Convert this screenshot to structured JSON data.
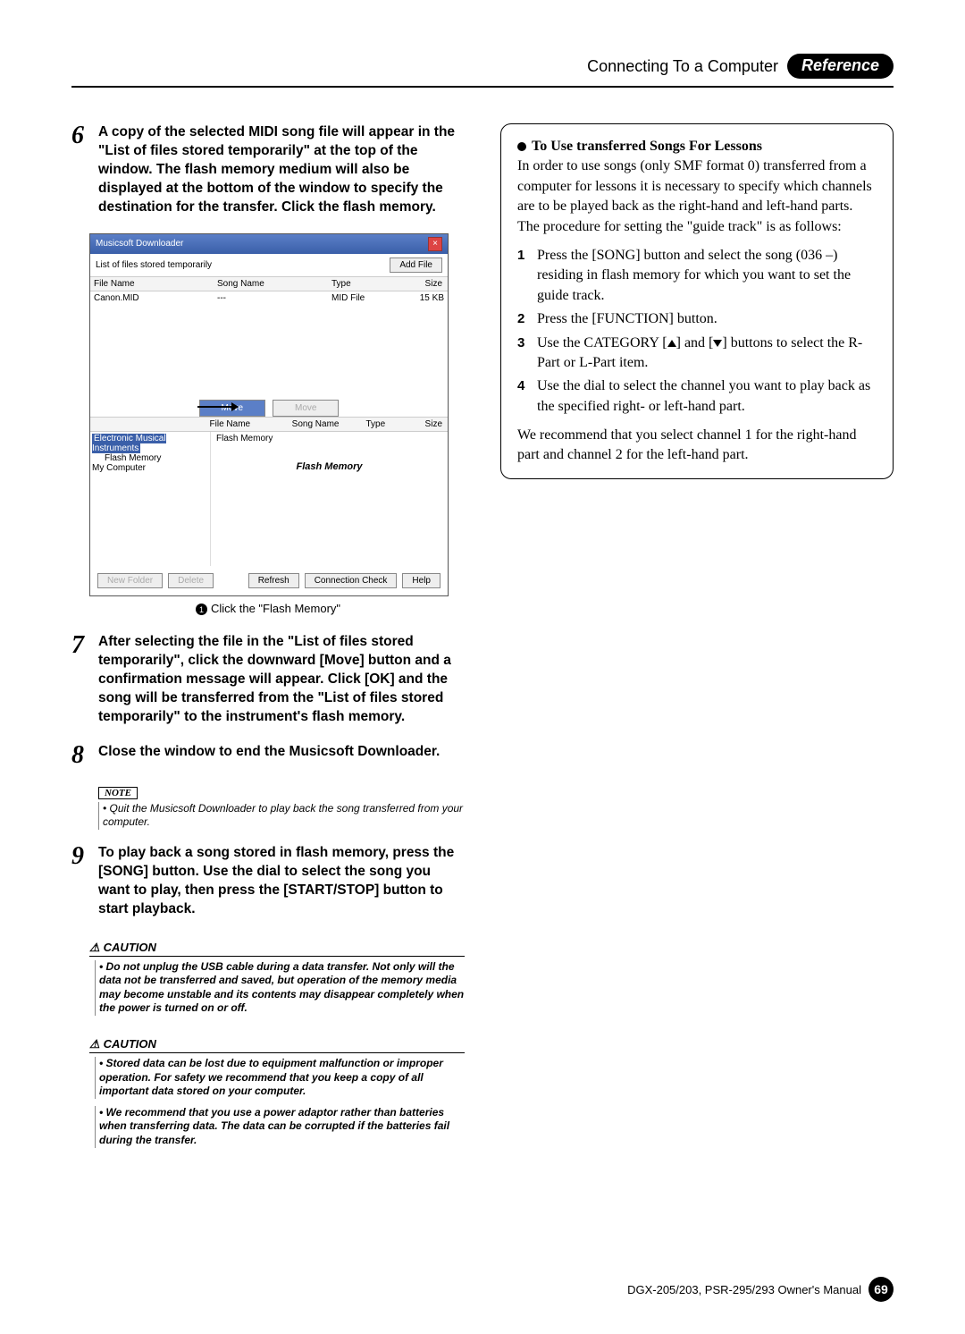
{
  "header": {
    "title": "Connecting To a Computer",
    "tag": "Reference"
  },
  "steps": {
    "s6": {
      "num": "6",
      "text": "A copy of the selected MIDI song file will appear in the \"List of files stored temporarily\" at the top of the window. The flash memory medium will also be displayed at the bottom of the window to specify the destination for the transfer. Click the flash memory."
    },
    "s7": {
      "num": "7",
      "text": "After selecting the file in the \"List of files stored temporarily\", click the downward [Move] button and a confirmation message will appear. Click [OK] and the song will be transferred from the \"List of files stored temporarily\" to the instrument's flash memory."
    },
    "s8": {
      "num": "8",
      "text": "Close the window to end the Musicsoft Downloader."
    },
    "s9": {
      "num": "9",
      "text": "To play back a song stored in flash memory, press the [SONG] button. Use the dial to select the song you want to play, then press the [START/STOP] button to start playback."
    }
  },
  "screenshot": {
    "title": "Musicsoft Downloader",
    "listLabel": "List of files stored temporarily",
    "addFile": "Add File",
    "cols": {
      "fileName": "File Name",
      "songName": "Song Name",
      "type": "Type",
      "size": "Size"
    },
    "row": {
      "fileName": "Canon.MID",
      "songName": "---",
      "type": "MID File",
      "size": "15 KB"
    },
    "moveBtn": "Move",
    "tree": {
      "root": "Electronic Musical Instruments",
      "flash": "Flash Memory",
      "myComp": "My Computer"
    },
    "treeItem": "Flash Memory",
    "flashArrowLabel": "Flash Memory",
    "buttons": {
      "newFolder": "New Folder",
      "delete": "Delete",
      "refresh": "Refresh",
      "connCheck": "Connection Check",
      "help": "Help"
    }
  },
  "caption1": "Click the \"Flash Memory\"",
  "note": {
    "label": "NOTE",
    "text": "• Quit the Musicsoft Downloader to play back the song transferred from your computer."
  },
  "caution1": {
    "label": "CAUTION",
    "text": "• Do not unplug the USB cable during a data transfer. Not only will the data not be transferred and saved, but operation of the memory media may become unstable and its contents may disappear completely when the power is turned on or off."
  },
  "caution2": {
    "label": "CAUTION",
    "text1": "• Stored data can be lost due to equipment malfunction or improper operation. For safety we recommend that you keep a copy of all important data stored on your computer.",
    "text2": "• We recommend that you use a power adaptor rather than batteries when transferring data. The data can be corrupted if the batteries fail during the transfer."
  },
  "right": {
    "heading": "To Use transferred Songs For Lessons",
    "intro": "In order to use songs (only SMF format 0) transferred from a computer for lessons it is necessary to specify which channels are to be played back as the right-hand and left-hand parts. The procedure for setting the \"guide track\" is as follows:",
    "items": {
      "i1": "Press the [SONG] button and select the song (036 –) residing in flash memory for which you want to set the guide track.",
      "i2": "Press the [FUNCTION] button.",
      "i3a": "Use the CATEGORY [",
      "i3b": "] and [",
      "i3c": "] buttons to select the R-Part or L-Part item.",
      "i4": "Use the dial to select the channel you want to play back as the specified right- or left-hand part."
    },
    "outro": "We recommend that you select channel 1 for the right-hand part and channel 2 for the left-hand part."
  },
  "footer": {
    "model": "DGX-205/203, PSR-295/293  Owner's Manual",
    "page": "69"
  }
}
